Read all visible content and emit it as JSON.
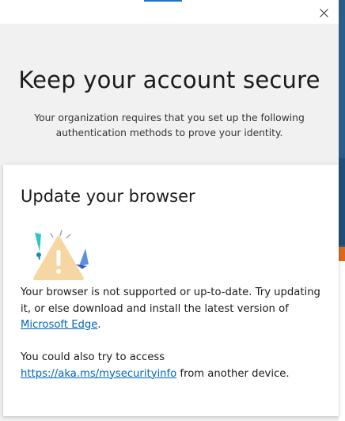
{
  "dialog": {
    "title": "Keep your account secure",
    "subtitle": "Your organization requires that you set up the following authentication methods to prove your identity.",
    "close_icon": "close-icon"
  },
  "card": {
    "title": "Update your browser",
    "illustration_icon": "warning-illustration-icon",
    "message_part1": "Your browser is not supported or up-to-date. Try updating it, or else download and install the latest version of ",
    "edge_link": "Microsoft Edge",
    "message_part1_end": ".",
    "message2_part1": "You could also try to access ",
    "security_link": "https://aka.ms/mysecurityinfo",
    "message2_part2": " from another device."
  },
  "colors": {
    "link": "#0067b8",
    "background": "#f1f1f1",
    "card": "#ffffff",
    "warning": "#f6d6a3"
  }
}
